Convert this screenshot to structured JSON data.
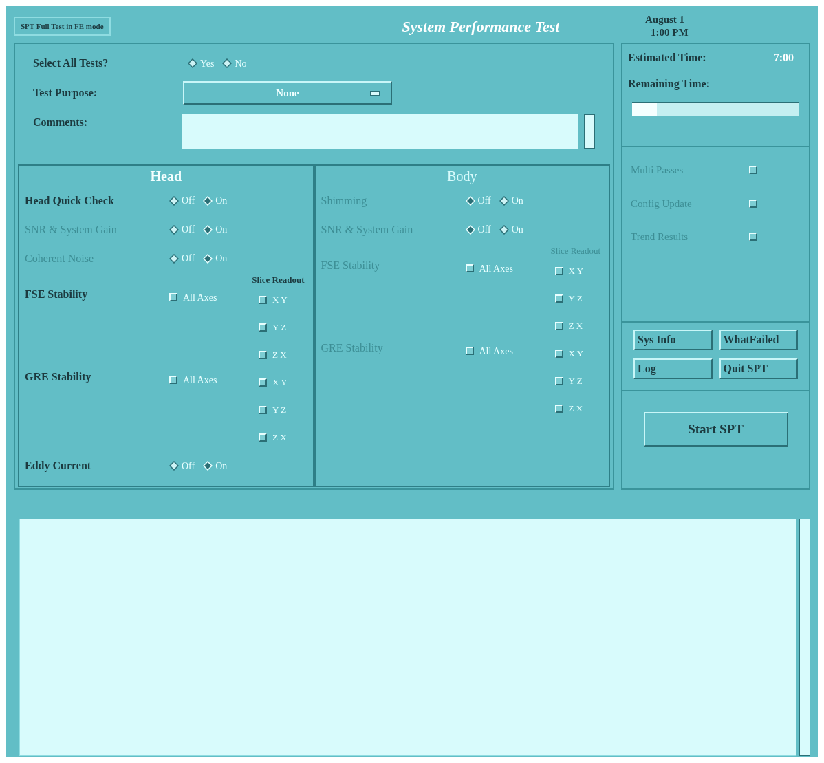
{
  "header": {
    "mode_label": "SPT Full Test in FE mode",
    "title": "System Performance Test",
    "date": "August 1",
    "time": "1:00 PM"
  },
  "setup": {
    "select_all": {
      "label": "Select All Tests?",
      "options": [
        {
          "label": "Yes",
          "selected": false
        },
        {
          "label": "No",
          "selected": false
        }
      ]
    },
    "test_purpose": {
      "label": "Test Purpose:",
      "value": "None"
    },
    "comments": {
      "label": "Comments:"
    }
  },
  "sections": [
    {
      "title": "Head",
      "disabled": false,
      "slice_header": "Slice Readout",
      "rows": [
        {
          "kind": "radio",
          "label": "Head Quick Check",
          "disabled": false,
          "options": [
            {
              "label": "Off",
              "selected": false
            },
            {
              "label": "On",
              "selected": true
            }
          ]
        },
        {
          "kind": "radio",
          "label": "SNR & System Gain",
          "disabled": true,
          "options": [
            {
              "label": "Off",
              "selected": false
            },
            {
              "label": "On",
              "selected": true
            }
          ]
        },
        {
          "kind": "radio",
          "label": "Coherent Noise",
          "disabled": true,
          "options": [
            {
              "label": "Off",
              "selected": false
            },
            {
              "label": "On",
              "selected": true
            }
          ]
        },
        {
          "kind": "axes",
          "label": "FSE Stability",
          "disabled": false,
          "all_axes": {
            "label": "All Axes",
            "checked": false
          },
          "slices": [
            {
              "label": "X Y",
              "checked": false
            },
            {
              "label": "Y Z",
              "checked": false
            },
            {
              "label": "Z X",
              "checked": false
            }
          ]
        },
        {
          "kind": "axes",
          "label": "GRE Stability",
          "disabled": false,
          "all_axes": {
            "label": "All Axes",
            "checked": false
          },
          "slices": [
            {
              "label": "X Y",
              "checked": false
            },
            {
              "label": "Y Z",
              "checked": false
            },
            {
              "label": "Z X",
              "checked": false
            }
          ]
        },
        {
          "kind": "radio",
          "label": "Eddy Current",
          "disabled": false,
          "options": [
            {
              "label": "Off",
              "selected": false
            },
            {
              "label": "On",
              "selected": true
            }
          ]
        }
      ]
    },
    {
      "title": "Body",
      "disabled": true,
      "slice_header": "Slice Readout",
      "rows": [
        {
          "kind": "radio",
          "label": "Shimming",
          "disabled": true,
          "options": [
            {
              "label": "Off",
              "selected": true
            },
            {
              "label": "On",
              "selected": false
            }
          ]
        },
        {
          "kind": "radio",
          "label": "SNR & System Gain",
          "disabled": true,
          "options": [
            {
              "label": "Off",
              "selected": true
            },
            {
              "label": "On",
              "selected": false
            }
          ]
        },
        {
          "kind": "axes",
          "label": "FSE Stability",
          "disabled": true,
          "all_axes": {
            "label": "All Axes",
            "checked": false
          },
          "slices": [
            {
              "label": "X Y",
              "checked": false
            },
            {
              "label": "Y Z",
              "checked": false
            },
            {
              "label": "Z X",
              "checked": false
            }
          ]
        },
        {
          "kind": "axes",
          "label": "GRE Stability",
          "disabled": true,
          "all_axes": {
            "label": "All Axes",
            "checked": false
          },
          "slices": [
            {
              "label": "X Y",
              "checked": false
            },
            {
              "label": "Y Z",
              "checked": false
            },
            {
              "label": "Z X",
              "checked": false
            }
          ]
        }
      ]
    }
  ],
  "timing": {
    "estimated_label": "Estimated Time:",
    "estimated_value": "7:00",
    "remaining_label": "Remaining Time:",
    "level": 0.15
  },
  "options": [
    {
      "label": "Multi Passes",
      "checked": false,
      "disabled": true
    },
    {
      "label": "Config Update",
      "checked": false,
      "disabled": true
    },
    {
      "label": "Trend Results",
      "checked": false,
      "disabled": true
    }
  ],
  "buttons": [
    "Sys Info",
    "WhatFailed",
    "Log",
    "Quit SPT"
  ],
  "start_button": "Start SPT"
}
